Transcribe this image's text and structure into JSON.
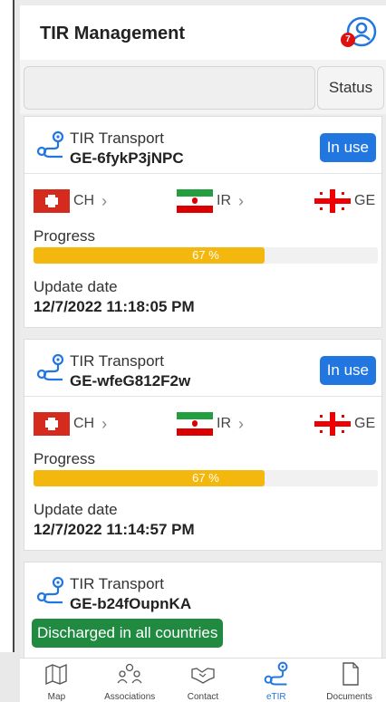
{
  "header": {
    "title": "TIR Management",
    "notification_count": "7"
  },
  "filter": {
    "status_label": "Status"
  },
  "cards": [
    {
      "title": "TIR Transport",
      "id": "GE-6fykP3jNPC",
      "badge": "In use",
      "countries": [
        "CH",
        "IR",
        "GE"
      ],
      "progress_label": "Progress",
      "progress_percent": 67,
      "progress_text": "67 %",
      "update_label": "Update date",
      "update_value": "12/7/2022 11:18:05 PM"
    },
    {
      "title": "TIR Transport",
      "id": "GE-wfeG812F2w",
      "badge": "In use",
      "countries": [
        "CH",
        "IR",
        "GE"
      ],
      "progress_label": "Progress",
      "progress_percent": 67,
      "progress_text": "67 %",
      "update_label": "Update date",
      "update_value": "12/7/2022 11:14:57 PM"
    },
    {
      "title": "TIR Transport",
      "id": "GE-b24fOupnKA",
      "badge": "Discharged in all countries"
    }
  ],
  "nav": [
    {
      "label": "Map",
      "icon": "map-icon"
    },
    {
      "label": "Associations",
      "icon": "people-icon"
    },
    {
      "label": "Contact",
      "icon": "handshake-icon"
    },
    {
      "label": "eTIR",
      "icon": "route-icon",
      "active": true
    },
    {
      "label": "Documents",
      "icon": "document-icon"
    }
  ],
  "colors": {
    "accent": "#2176e0",
    "progress": "#f4b70d",
    "success": "#1f8a40",
    "notification": "#dd1111"
  }
}
